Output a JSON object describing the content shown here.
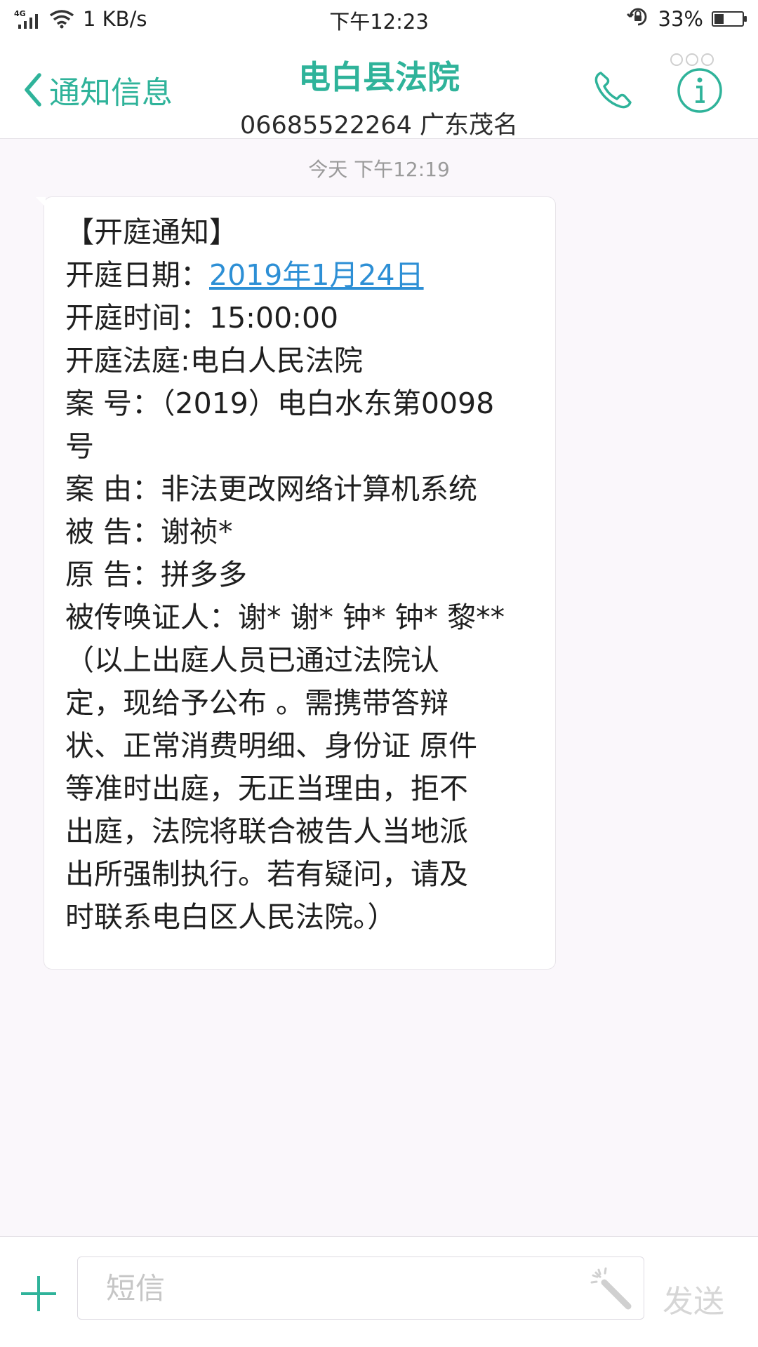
{
  "status_bar": {
    "network_type": "4G",
    "speed": "1 KB/s",
    "time": "下午12:23",
    "battery": "33%",
    "battery_level": 0.33
  },
  "header": {
    "back_label": "通知信息",
    "title": "电白县法院",
    "subtitle": "06685522264  广东茂名",
    "call_icon": "phone-icon",
    "info_icon": "info-icon"
  },
  "conversation": {
    "timestamp": "今天 下午12:19",
    "message": {
      "line1": "【开庭通知】",
      "date_label": "开庭日期：",
      "date_value": "2019年1月24日",
      "lines": [
        "开庭时间：15:00:00",
        "开庭法庭:电白人民法院",
        "案 号：（2019）电白水东第0098",
        "号",
        "案 由：非法更改网络计算机系统",
        "被 告：谢祯*",
        "原 告：拼多多",
        "被传唤证人：谢* 谢* 钟* 钟* 黎**",
        "（以上出庭人员已通过法院认",
        "定，现给予公布 。需携带答辩",
        "状、正常消费明细、身份证 原件",
        "等准时出庭，无正当理由，拒不",
        "出庭，法院将联合被告人当地派",
        "出所强制执行。若有疑问，请及",
        "时联系电白区人民法院。）"
      ]
    }
  },
  "composer": {
    "add_icon": "plus-icon",
    "placeholder": "短信",
    "magic_icon": "wand-icon",
    "send_label": "发送"
  },
  "colors": {
    "accent": "#2fb39a",
    "link": "#2d8fd5",
    "background": "#faf7fb"
  }
}
